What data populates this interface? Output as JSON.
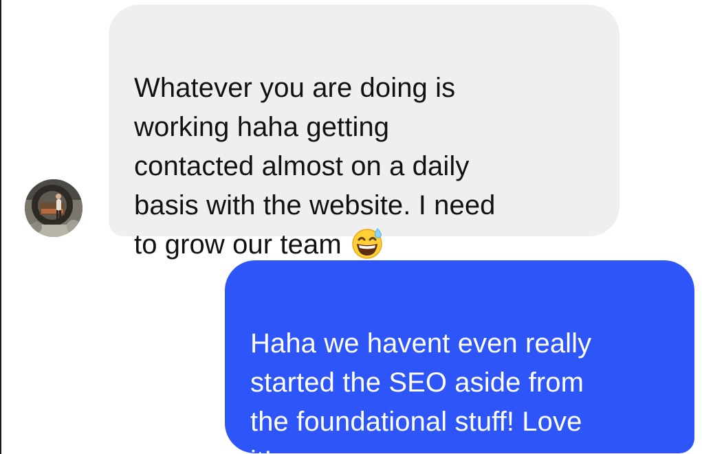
{
  "messages": [
    {
      "direction": "received",
      "text": "Whatever you are doing is\nworking haha getting\ncontacted almost on a daily\nbasis with the website. I need\nto grow our team",
      "emoji": "grinning-face-with-sweat-emoji"
    },
    {
      "direction": "sent",
      "text": "Haha we havent even really\nstarted the SEO aside from\nthe foundational stuff! Love\nit!"
    }
  ],
  "colors": {
    "received_bubble": "#efefef",
    "received_text": "#111111",
    "sent_bubble": "#2d55f8",
    "sent_text": "#ffffff"
  },
  "icons": {
    "avatar": "contact-avatar-photo",
    "emoji": "grinning-face-with-sweat-emoji"
  }
}
